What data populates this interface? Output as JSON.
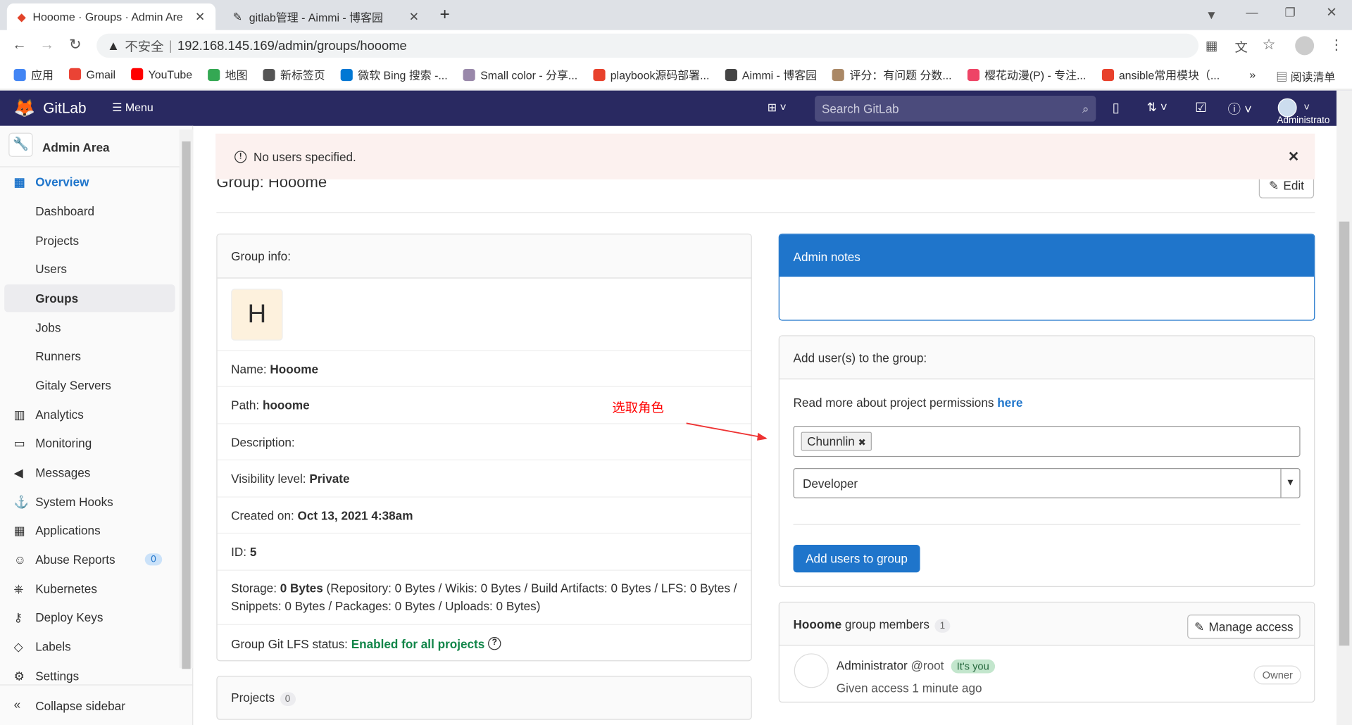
{
  "browser": {
    "tabs": [
      {
        "title": "Hooome · Groups · Admin Are",
        "active": true
      },
      {
        "title": "gitlab管理 - Aimmi - 博客园",
        "active": false
      }
    ],
    "insecure_label": "不安全",
    "url": "192.168.145.169/admin/groups/hooome",
    "bookmarks": [
      {
        "label": "应用",
        "color": "#4285f4"
      },
      {
        "label": "Gmail",
        "color": "#ea4335"
      },
      {
        "label": "YouTube",
        "color": "#ff0000"
      },
      {
        "label": "地图",
        "color": "#34a853"
      },
      {
        "label": "新标签页",
        "color": "#555555"
      },
      {
        "label": "微软 Bing 搜索 -...",
        "color": "#0078d4"
      },
      {
        "label": "Small color - 分享...",
        "color": "#9988aa"
      },
      {
        "label": "playbook源码部署...",
        "color": "#e8412c"
      },
      {
        "label": "Aimmi - 博客园",
        "color": "#444444"
      },
      {
        "label": "评分：有问题 分数...",
        "color": "#aa8866"
      },
      {
        "label": "樱花动漫(P) - 专注...",
        "color": "#ee4466"
      },
      {
        "label": "ansible常用模块（...",
        "color": "#e8412c"
      }
    ],
    "reading_list": "阅读清单",
    "more": "»"
  },
  "header": {
    "brand": "GitLab",
    "menu": "Menu",
    "search_placeholder": "Search GitLab",
    "user": "Administrato"
  },
  "sidebar": {
    "title": "Admin Area",
    "items": [
      {
        "label": "Overview",
        "icon": "grid-icon",
        "section": true
      },
      {
        "label": "Dashboard"
      },
      {
        "label": "Projects"
      },
      {
        "label": "Users"
      },
      {
        "label": "Groups",
        "active": true
      },
      {
        "label": "Jobs"
      },
      {
        "label": "Runners"
      },
      {
        "label": "Gitaly Servers"
      },
      {
        "label": "Analytics",
        "icon": "chart-icon",
        "section": true
      },
      {
        "label": "Monitoring",
        "icon": "monitor-icon",
        "section": true
      },
      {
        "label": "Messages",
        "icon": "megaphone-icon",
        "section": true
      },
      {
        "label": "System Hooks",
        "icon": "hook-icon",
        "section": true
      },
      {
        "label": "Applications",
        "icon": "apps-icon",
        "section": true
      },
      {
        "label": "Abuse Reports",
        "icon": "face-icon",
        "section": true,
        "badge": "0"
      },
      {
        "label": "Kubernetes",
        "icon": "kubernetes-icon",
        "section": true
      },
      {
        "label": "Deploy Keys",
        "icon": "key-icon",
        "section": true
      },
      {
        "label": "Labels",
        "icon": "label-icon",
        "section": true
      },
      {
        "label": "Settings",
        "icon": "gear-icon",
        "section": true
      }
    ],
    "collapse": "Collapse sidebar"
  },
  "alert": {
    "text": "No users specified."
  },
  "page": {
    "title": "Group: Hooome",
    "edit": "Edit"
  },
  "group_info": {
    "header": "Group info:",
    "avatar_letter": "H",
    "name_label": "Name:",
    "name": "Hooome",
    "path_label": "Path:",
    "path": "hooome",
    "description_label": "Description:",
    "visibility_label": "Visibility level:",
    "visibility": "Private",
    "created_label": "Created on:",
    "created": "Oct 13, 2021 4:38am",
    "id_label": "ID:",
    "id": "5",
    "storage_label": "Storage:",
    "storage": "0 Bytes",
    "storage_detail": "(Repository: 0 Bytes / Wikis: 0 Bytes / Build Artifacts: 0 Bytes / LFS: 0 Bytes / Snippets: 0 Bytes / Packages: 0 Bytes / Uploads: 0 Bytes)",
    "lfs_label": "Group Git LFS status:",
    "lfs": "Enabled for all projects"
  },
  "projects": {
    "label": "Projects",
    "count": "0"
  },
  "admin_notes": {
    "header": "Admin notes"
  },
  "add_users": {
    "header": "Add user(s) to the group:",
    "perm_text": "Read more about project permissions",
    "perm_link": "here",
    "token": "Chunnlin",
    "role": "Developer",
    "button": "Add users to group"
  },
  "members": {
    "group": "Hooome",
    "label": "group members",
    "count": "1",
    "manage": "Manage access",
    "list": [
      {
        "name": "Administrator",
        "username": "@root",
        "badge": "It's you",
        "meta": "Given access 1 minute ago",
        "role": "Owner"
      }
    ]
  },
  "annotation": {
    "text": "选取角色",
    "color": "#ff0000"
  }
}
